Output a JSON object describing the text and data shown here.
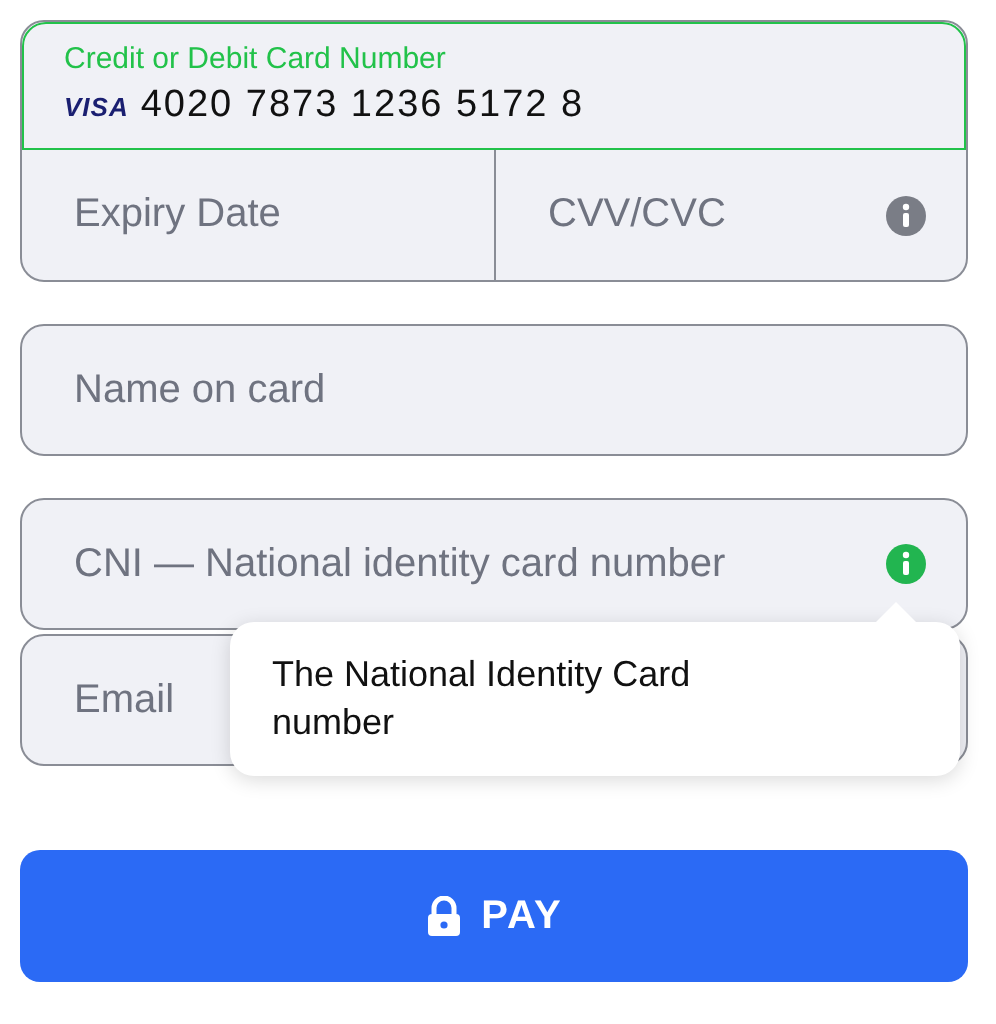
{
  "card": {
    "label": "Credit or Debit Card Number",
    "brand": "VISA",
    "value": "4020 7873 1236 5172 8",
    "focused": true,
    "expiry": {
      "placeholder": "Expiry Date"
    },
    "cvv": {
      "placeholder": "CVV/CVC",
      "info": true,
      "info_active": false
    }
  },
  "fields": [
    {
      "placeholder": "Name on card",
      "info": false,
      "info_active": false
    },
    {
      "placeholder": "CNI — National identity card number",
      "info": true,
      "info_active": true
    },
    {
      "placeholder": "Email"
    }
  ],
  "tooltip": {
    "text": "The National Identity Card number"
  },
  "pay_button": {
    "label": "PAY"
  }
}
